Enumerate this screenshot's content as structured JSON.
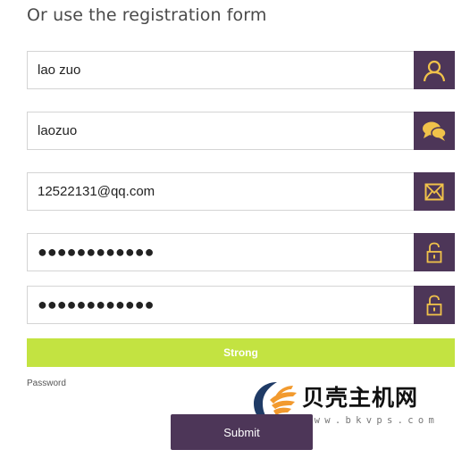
{
  "form": {
    "title": "Or use the registration form",
    "name_value": "lao zuo",
    "username_value": "laozuo",
    "email_value": "12522131@qq.com",
    "password_value": "●●●●●●●●●●●●",
    "confirm_value": "●●●●●●●●●●●●",
    "strength_label": "Strong",
    "password_label": "Password",
    "submit_label": "Submit"
  },
  "icons": {
    "name": "user-icon",
    "username": "chat-bubbles-icon",
    "email": "envelope-icon",
    "password": "lock-icon",
    "confirm": "lock-icon"
  },
  "colors": {
    "icon_bg": "#4d3658",
    "icon_fg": "#f0c24a",
    "strength_bar": "#c3e341"
  },
  "watermark": {
    "name": "贝壳主机网",
    "url": "www.bkvps.com"
  }
}
